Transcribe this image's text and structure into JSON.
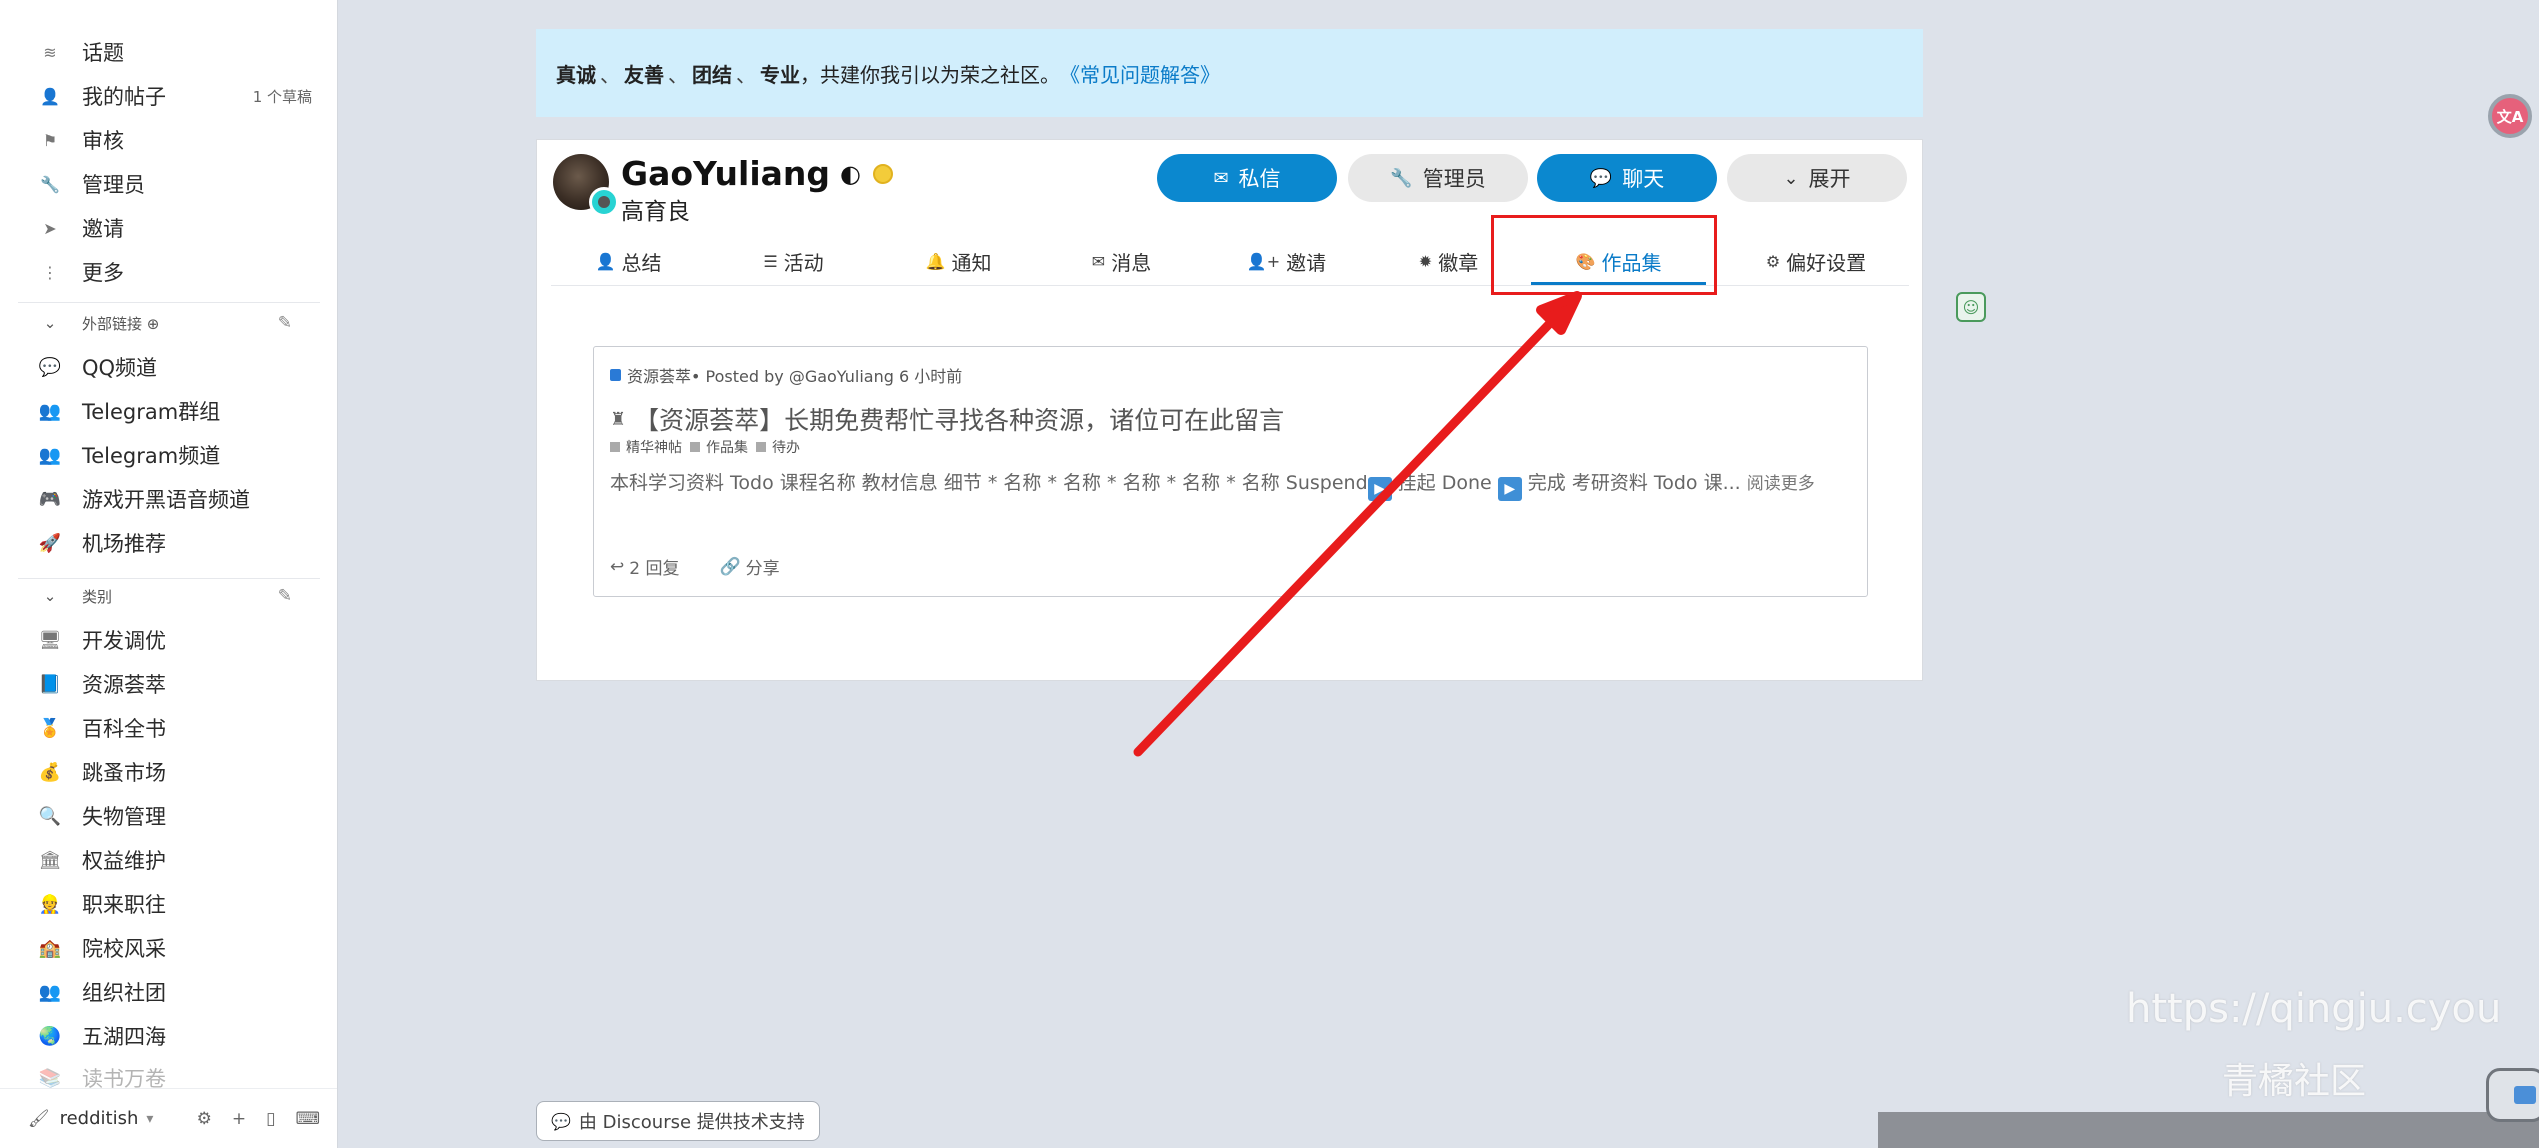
{
  "sidebar": {
    "items_top": [
      {
        "label": "话题",
        "icon": "layers-icon",
        "glyph": "≋"
      },
      {
        "label": "我的帖子",
        "icon": "user-icon",
        "glyph": "👤",
        "count": "1 个草稿"
      },
      {
        "label": "审核",
        "icon": "flag-icon",
        "glyph": "⚑"
      },
      {
        "label": "管理员",
        "icon": "wrench-icon",
        "glyph": "🔧"
      },
      {
        "label": "邀请",
        "icon": "paper-plane-icon",
        "glyph": "➤"
      },
      {
        "label": "更多",
        "icon": "more-vertical-icon",
        "glyph": "⋮"
      }
    ],
    "links_section": {
      "label": "外部链接 ⊕"
    },
    "links": [
      {
        "label": "QQ频道",
        "icon": "chat-bubbles-icon",
        "glyph": "💬"
      },
      {
        "label": "Telegram群组",
        "icon": "users-icon",
        "glyph": "👥"
      },
      {
        "label": "Telegram频道",
        "icon": "users-icon",
        "glyph": "👥"
      },
      {
        "label": "游戏开黑语音频道",
        "icon": "discord-icon",
        "glyph": "🎮"
      },
      {
        "label": "机场推荐",
        "icon": "rocket-icon",
        "glyph": "🚀"
      }
    ],
    "categories_section": {
      "label": "类别"
    },
    "categories": [
      {
        "label": "开发调优",
        "icon": "monitor-icon",
        "glyph": "🖥"
      },
      {
        "label": "资源荟萃",
        "icon": "book-icon",
        "glyph": "📘"
      },
      {
        "label": "百科全书",
        "icon": "medal-icon",
        "glyph": "🏅"
      },
      {
        "label": "跳蚤市场",
        "icon": "money-bag-icon",
        "glyph": "💰"
      },
      {
        "label": "失物管理",
        "icon": "magnifier-icon",
        "glyph": "🔍"
      },
      {
        "label": "权益维护",
        "icon": "bank-icon",
        "glyph": "🏛"
      },
      {
        "label": "职来职往",
        "icon": "worker-icon",
        "glyph": "👷"
      },
      {
        "label": "院校风采",
        "icon": "school-icon",
        "glyph": "🏫"
      },
      {
        "label": "组织社团",
        "icon": "people-icon",
        "glyph": "👥"
      },
      {
        "label": "五湖四海",
        "icon": "globe-icon",
        "glyph": "🌏"
      },
      {
        "label": "读书万卷",
        "icon": "books-icon",
        "glyph": "📚"
      }
    ],
    "footer": {
      "theme_label": "redditish",
      "theme_glyph": "🖌"
    }
  },
  "banner": {
    "w1": "真诚",
    "w2": "友善",
    "w3": "团结",
    "w4": "专业",
    "sep": "、",
    "tail": "，共建你我引以为荣之社区。",
    "link": "《常见问题解答》"
  },
  "profile": {
    "username": "GaoYuliang",
    "name": "高育良",
    "buttons": {
      "message": "私信",
      "admin": "管理员",
      "chat": "聊天",
      "expand": "展开"
    },
    "tabs": [
      {
        "label": "总结",
        "glyph": "👤",
        "icon": "user-icon"
      },
      {
        "label": "活动",
        "glyph": "☰",
        "icon": "list-icon"
      },
      {
        "label": "通知",
        "glyph": "🔔",
        "icon": "bell-icon"
      },
      {
        "label": "消息",
        "glyph": "✉",
        "icon": "envelope-icon"
      },
      {
        "label": "邀请",
        "glyph": "👤+",
        "icon": "user-plus-icon"
      },
      {
        "label": "徽章",
        "glyph": "✹",
        "icon": "certificate-icon"
      },
      {
        "label": "作品集",
        "glyph": "🎨",
        "icon": "palette-icon"
      },
      {
        "label": "偏好设置",
        "glyph": "⚙",
        "icon": "gear-icon"
      }
    ]
  },
  "post": {
    "category": "资源荟萃",
    "meta": " • Posted by @GaoYuliang 6 小时前",
    "title": "【资源荟萃】长期免费帮忙寻找各种资源，诸位可在此留言",
    "tags": [
      "精华神帖",
      "作品集",
      "待办"
    ],
    "excerpt_a": "本科学习资料 Todo 课程名称 教材信息 细节 * 名称 * 名称 * 名称 * 名称 * 名称 Suspend",
    "excerpt_b": " 挂起 Done ",
    "excerpt_c": " 完成 考研资料 Todo 课... ",
    "read_more": "阅读更多",
    "replies": "2 回复",
    "share": "分享"
  },
  "powered_by": "由 Discourse 提供技术支持",
  "watermark": {
    "url": "https://qingju.cyou",
    "name": "青橘社区"
  },
  "translate_label": "文A",
  "colors": {
    "accent": "#0a7bc8",
    "button_primary": "#0b88cf",
    "banner_bg": "#d1eefc",
    "highlight": "#e81c1c",
    "page_bg": "#dde2ea"
  }
}
